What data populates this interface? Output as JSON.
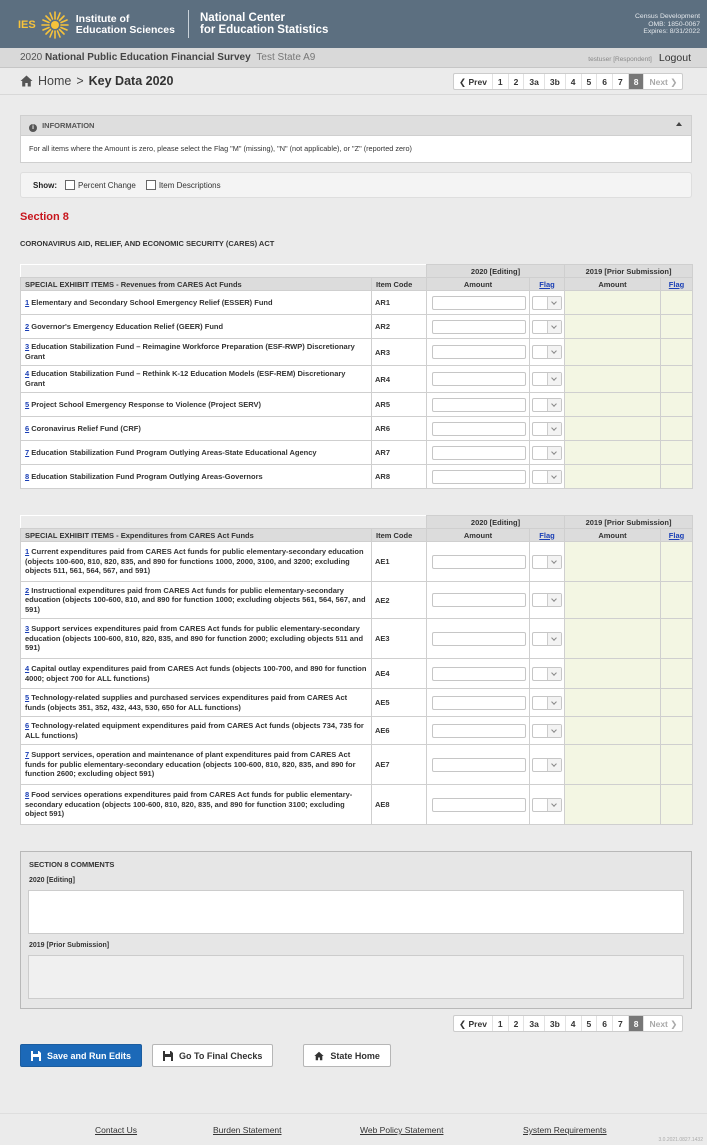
{
  "header": {
    "ies_abbr": "IES",
    "ies_name_line1": "Institute of",
    "ies_name_line2": "Education Sciences",
    "nces_line1": "National Center",
    "nces_line2": "for Education Statistics",
    "census_line1": "Census Development",
    "census_line2": "OMB: 1850-0067",
    "census_line3": "Expires: 8/31/2022"
  },
  "survey": {
    "year_prefix": "2020",
    "title": "National Public Education Financial Survey",
    "state": "Test State A9",
    "user": "testuser [Respondent]",
    "logout": "Logout"
  },
  "breadcrumb": {
    "home": "Home",
    "separator": ">",
    "current": "Key Data 2020"
  },
  "pager": {
    "prev": "❮ Prev",
    "pages": [
      "1",
      "2",
      "3a",
      "3b",
      "4",
      "5",
      "6",
      "7",
      "8"
    ],
    "active": "8",
    "next": "Next ❯"
  },
  "info": {
    "title": "INFORMATION",
    "text": "For all items where the Amount is zero, please select the Flag \"M\" (missing), \"N\" (not applicable), or \"Z\" (reported zero)"
  },
  "show": {
    "label": "Show:",
    "percent_change": "Percent Change",
    "item_descriptions": "Item Descriptions"
  },
  "section": {
    "title": "Section 8",
    "act": "CORONAVIRUS AID, RELIEF, AND ECONOMIC SECURITY (CARES) ACT"
  },
  "columns": {
    "editing": "2020 [Editing]",
    "prior": "2019 [Prior Submission]",
    "item_code": "Item Code",
    "amount": "Amount",
    "flag": "Flag"
  },
  "revenues": {
    "title": "SPECIAL EXHIBIT ITEMS - Revenues from CARES Act Funds",
    "rows": [
      {
        "num": "1",
        "text": " Elementary and Secondary School Emergency Relief (ESSER) Fund",
        "code": "AR1"
      },
      {
        "num": "2",
        "text": " Governor's Emergency Education Relief (GEER) Fund",
        "code": "AR2"
      },
      {
        "num": "3",
        "text": " Education Stabilization Fund – Reimagine Workforce Preparation (ESF-RWP) Discretionary Grant",
        "code": "AR3"
      },
      {
        "num": "4",
        "text": " Education Stabilization Fund – Rethink K-12 Education Models (ESF-REM) Discretionary Grant",
        "code": "AR4"
      },
      {
        "num": "5",
        "text": " Project School Emergency Response to Violence (Project SERV)",
        "code": "AR5"
      },
      {
        "num": "6",
        "text": " Coronavirus Relief Fund (CRF)",
        "code": "AR6"
      },
      {
        "num": "7",
        "text": " Education Stabilization Fund Program Outlying Areas-State Educational Agency",
        "code": "AR7"
      },
      {
        "num": "8",
        "text": " Education Stabilization Fund Program Outlying Areas-Governors",
        "code": "AR8"
      }
    ]
  },
  "expenditures": {
    "title": "SPECIAL EXHIBIT ITEMS - Expenditures from CARES Act Funds",
    "rows": [
      {
        "num": "1",
        "text": " Current expenditures paid from CARES Act funds for public elementary-secondary education (objects 100-600, 810, 820, 835, and 890 for functions 1000, 2000, 3100, and 3200; excluding objects 511, 561, 564, 567, and 591)",
        "code": "AE1"
      },
      {
        "num": "2",
        "text": " Instructional expenditures paid from CARES Act funds for public elementary-secondary education (objects 100-600, 810, and 890 for function 1000; excluding objects 561, 564, 567, and 591)",
        "code": "AE2"
      },
      {
        "num": "3",
        "text": " Support services expenditures paid from CARES Act funds for public elementary-secondary education (objects 100-600, 810, 820, 835, and 890 for function 2000; excluding objects 511 and 591)",
        "code": "AE3"
      },
      {
        "num": "4",
        "text": " Capital outlay expenditures paid from CARES Act funds (objects 100-700, and 890 for function 4000; object 700 for ALL functions)",
        "code": "AE4"
      },
      {
        "num": "5",
        "text": " Technology-related supplies and purchased services expenditures paid from CARES Act funds (objects 351, 352, 432, 443, 530, 650 for ALL functions)",
        "code": "AE5"
      },
      {
        "num": "6",
        "text": " Technology-related equipment expenditures paid from CARES Act funds (objects 734, 735 for ALL functions)",
        "code": "AE6"
      },
      {
        "num": "7",
        "text": " Support services, operation and maintenance of plant expenditures paid from CARES Act funds for public elementary-secondary education (objects 100-600, 810, 820, 835, and 890 for function 2600; excluding object 591)",
        "code": "AE7"
      },
      {
        "num": "8",
        "text": " Food services operations expenditures paid from CARES Act funds for public elementary-secondary education (objects 100-600, 810, 820, 835, and 890 for function 3100; excluding object 591)",
        "code": "AE8"
      }
    ]
  },
  "comments": {
    "title": "SECTION 8 COMMENTS",
    "editing_label": "2020 [Editing]",
    "prior_label": "2019 [Prior Submission]"
  },
  "buttons": {
    "save_run": "Save and Run Edits",
    "final_checks": "Go To Final Checks",
    "state_home": "State Home"
  },
  "footer": {
    "contact": "Contact Us",
    "burden": "Burden Statement",
    "web_policy": "Web Policy Statement",
    "system_req": "System Requirements",
    "version": "3.0.2021.0827.1432"
  },
  "colors": {
    "header_bg": "#5c6f80",
    "section_red": "#c8161d",
    "primary_blue": "#1c69b8",
    "prior_bg": "#f3f6e3",
    "link_blue": "#1a3fb5"
  }
}
